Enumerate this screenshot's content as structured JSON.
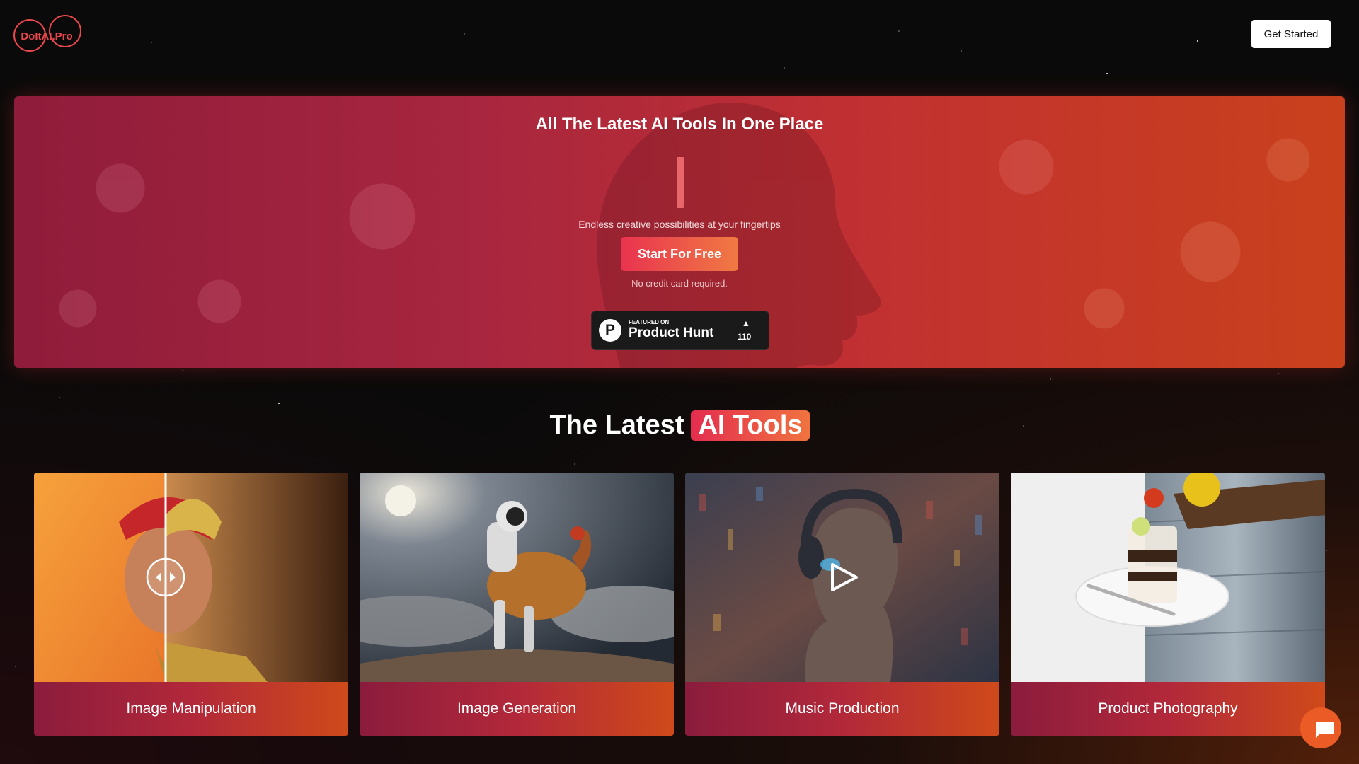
{
  "header": {
    "logo_text": "DoItAI.Pro",
    "cta_label": "Get Started"
  },
  "hero": {
    "title": "All The Latest AI Tools In One Place",
    "tagline": "Endless creative possibilities at your fingertips",
    "start_label": "Start For Free",
    "note": "No credit card required.",
    "product_hunt": {
      "featured_on": "FEATURED ON",
      "name": "Product Hunt",
      "upvotes": "110"
    }
  },
  "section": {
    "title_plain": "The Latest",
    "title_highlight": "AI Tools"
  },
  "cards": [
    {
      "label": "Image Manipulation",
      "icon": "compare-slider-icon"
    },
    {
      "label": "Image Generation",
      "icon": "astronaut-image"
    },
    {
      "label": "Music Production",
      "icon": "play-icon"
    },
    {
      "label": "Product Photography",
      "icon": "dessert-image"
    }
  ],
  "chat": {
    "icon": "chat-icon"
  },
  "colors": {
    "accent_start": "#e9334f",
    "accent_end": "#f07a43",
    "hero_left": "#8f1c3b",
    "hero_right": "#c8411c",
    "background": "#0b0a0a",
    "chat_button": "#ea5b25"
  }
}
